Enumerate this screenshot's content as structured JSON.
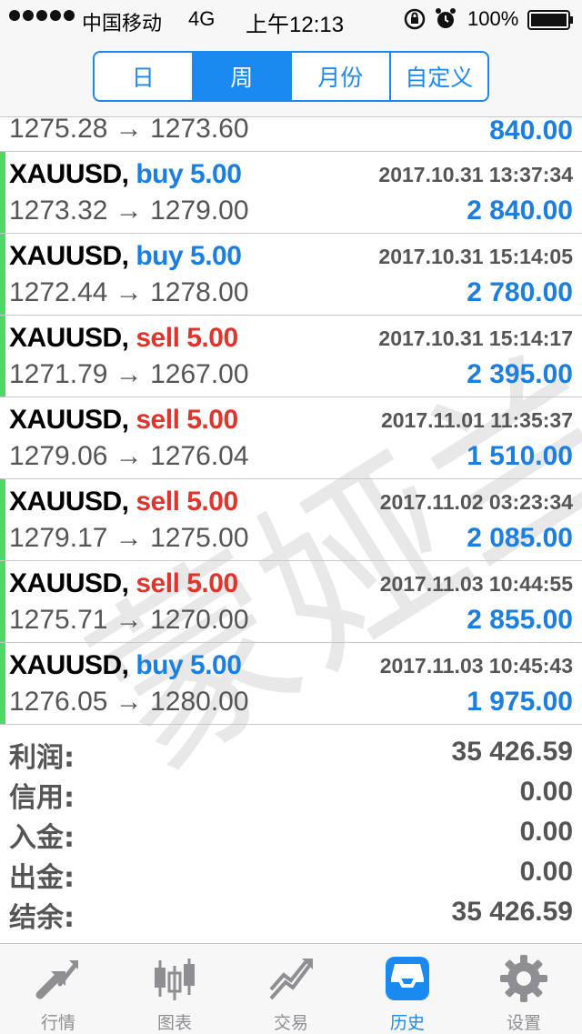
{
  "status_bar": {
    "carrier": "中国移动",
    "network": "4G",
    "time": "上午12:13",
    "battery": "100%"
  },
  "segmented": {
    "items": [
      "日",
      "周",
      "月份",
      "自定义"
    ],
    "active_index": 1
  },
  "partial_row": {
    "prices": "1275.28 → 1273.60",
    "profit": "840.00"
  },
  "trades": [
    {
      "symbol": "XAUUSD,",
      "side": "buy 5.00",
      "time": "2017.10.31 13:37:34",
      "prices": "1273.32 → 1279.00",
      "profit": "2 840.00"
    },
    {
      "symbol": "XAUUSD,",
      "side": "buy 5.00",
      "time": "2017.10.31 15:14:05",
      "prices": "1272.44 → 1278.00",
      "profit": "2 780.00"
    },
    {
      "symbol": "XAUUSD,",
      "side": "sell 5.00",
      "time": "2017.10.31 15:14:17",
      "prices": "1271.79 → 1267.00",
      "profit": "2 395.00"
    },
    {
      "symbol": "XAUUSD,",
      "side": "sell 5.00",
      "time": "2017.11.01 11:35:37",
      "prices": "1279.06 → 1276.04",
      "profit": "1 510.00"
    },
    {
      "symbol": "XAUUSD,",
      "side": "sell 5.00",
      "time": "2017.11.02 03:23:34",
      "prices": "1279.17 → 1275.00",
      "profit": "2 085.00"
    },
    {
      "symbol": "XAUUSD,",
      "side": "sell 5.00",
      "time": "2017.11.03 10:44:55",
      "prices": "1275.71 → 1270.00",
      "profit": "2 855.00"
    },
    {
      "symbol": "XAUUSD,",
      "side": "buy 5.00",
      "time": "2017.11.03 10:45:43",
      "prices": "1276.05 → 1280.00",
      "profit": "1 975.00"
    }
  ],
  "trade_bars": [
    true,
    true,
    true,
    false,
    true,
    true,
    true
  ],
  "summary": [
    {
      "label": "利润:",
      "value": "35 426.59"
    },
    {
      "label": "信用:",
      "value": "0.00"
    },
    {
      "label": "入金:",
      "value": "0.00"
    },
    {
      "label": "出金:",
      "value": "0.00"
    },
    {
      "label": "结余:",
      "value": "35 426.59"
    }
  ],
  "watermark": "蒙娅兰",
  "colors": {
    "accent": "#1a8af0",
    "buy": "#1a7fe0",
    "sell": "#e0352b",
    "bar": "#4cd964"
  },
  "tabbar": {
    "items": [
      {
        "label": "行情",
        "icon": "quotes-arrows-icon"
      },
      {
        "label": "图表",
        "icon": "candlestick-chart-icon"
      },
      {
        "label": "交易",
        "icon": "trade-trend-icon"
      },
      {
        "label": "历史",
        "icon": "history-inbox-icon"
      },
      {
        "label": "设置",
        "icon": "gear-icon"
      }
    ],
    "active_index": 3
  }
}
